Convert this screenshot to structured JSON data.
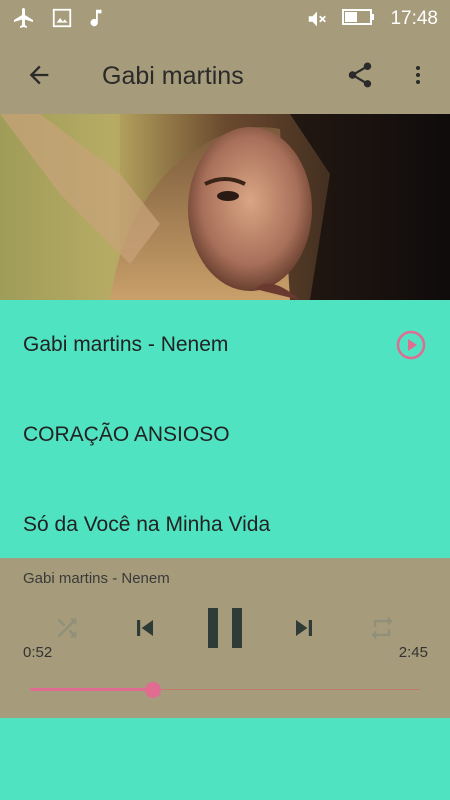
{
  "status_bar": {
    "time": "17:48",
    "icons": [
      "airplane-icon",
      "image-icon",
      "music-note-icon",
      "mute-icon",
      "battery-icon"
    ]
  },
  "app_bar": {
    "title": "Gabi martins",
    "icons": [
      "back-arrow-icon",
      "share-icon",
      "more-vert-icon"
    ]
  },
  "tracks": [
    {
      "title": "Gabi martins - Nenem",
      "playing": true
    },
    {
      "title": "CORAÇÃO ANSIOSO",
      "playing": false
    },
    {
      "title": "Só da Você na Minha Vida",
      "playing": false
    }
  ],
  "player": {
    "now_playing": "Gabi martins - Nenem",
    "elapsed": "0:52",
    "duration": "2:45",
    "progress_fraction": 0.315
  },
  "colors": {
    "bars": "#a69b7a",
    "list_background": "#50e3c2",
    "accent": "#e06c92",
    "icon_dark": "#2f3b36"
  }
}
